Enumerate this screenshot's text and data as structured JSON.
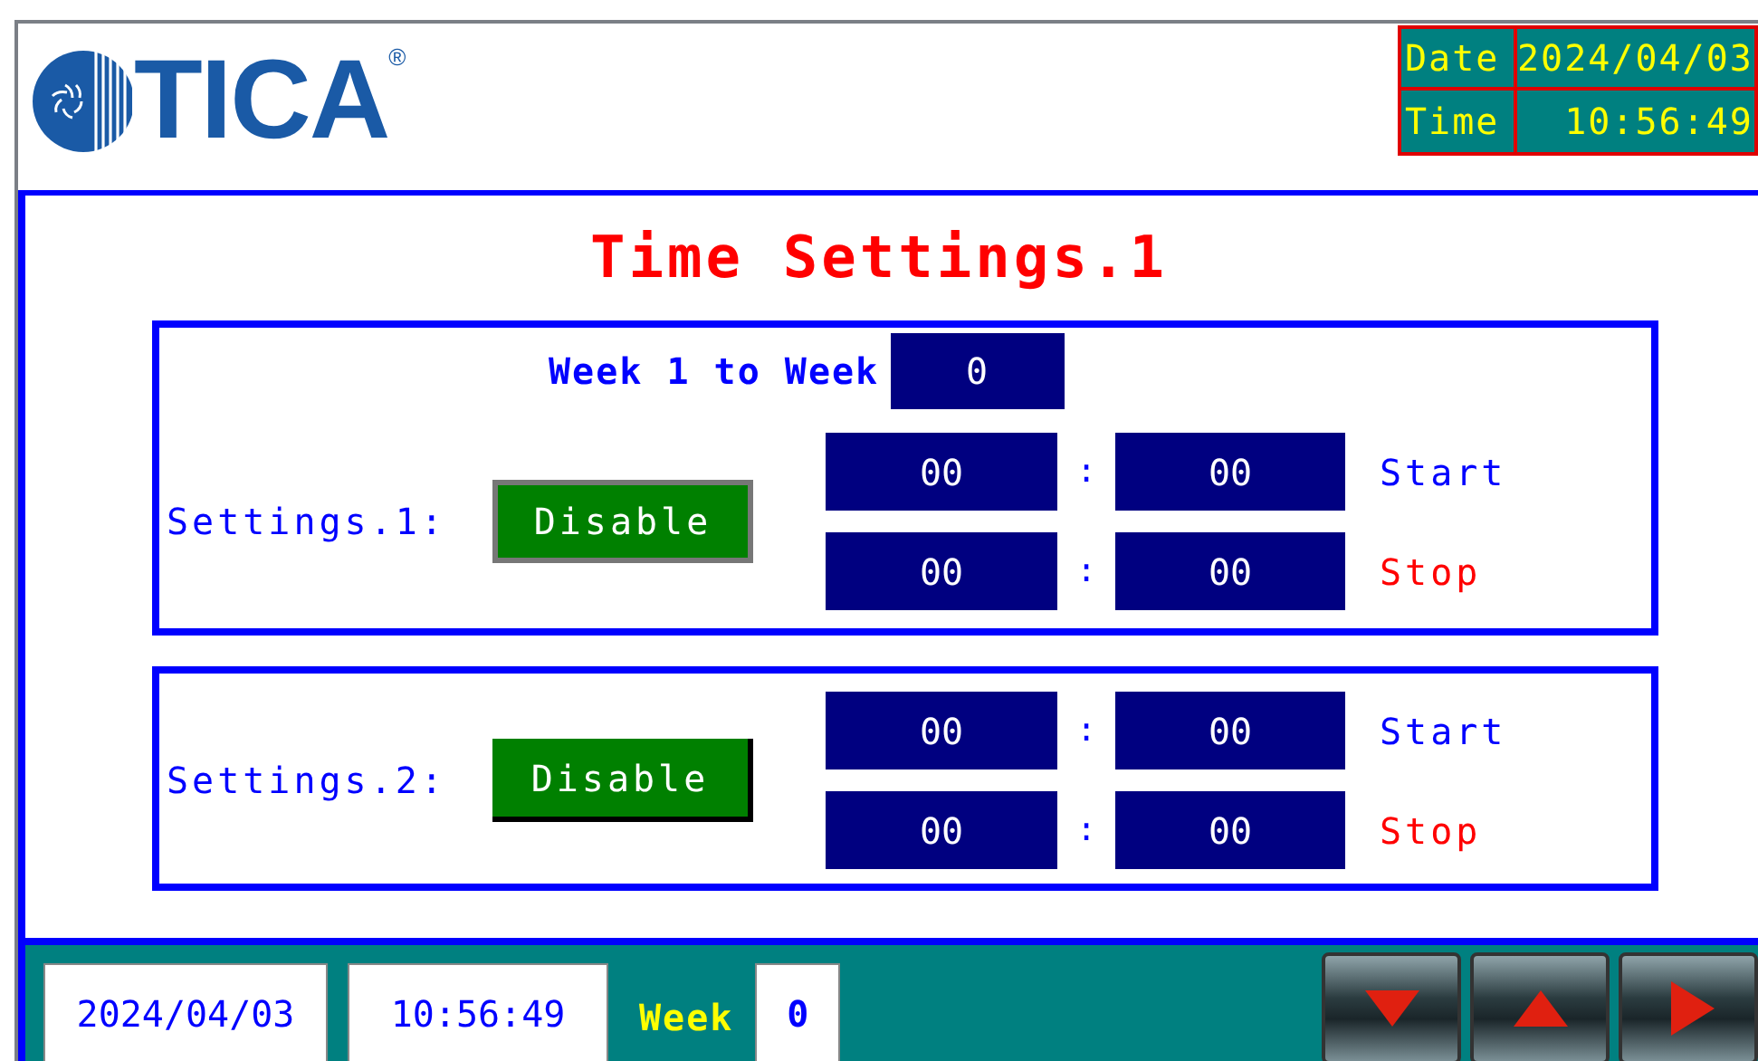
{
  "header": {
    "logo": "TICA",
    "registered": "®",
    "date_label": "Date",
    "date": "2024/04/03",
    "time_label": "Time",
    "time": "10:56:49"
  },
  "title": "Time Settings.1",
  "settings": [
    {
      "label": "Settings.1:",
      "button": "Disable",
      "focused": true,
      "week_range": {
        "label": "Week 1 to Week",
        "value": "0"
      },
      "rows": [
        {
          "hour": "00",
          "separator": ":",
          "minute": "00",
          "action": "Start",
          "kind": "start"
        },
        {
          "hour": "00",
          "separator": ":",
          "minute": "00",
          "action": "Stop",
          "kind": "stop"
        }
      ]
    },
    {
      "label": "Settings.2:",
      "button": "Disable",
      "focused": false,
      "rows": [
        {
          "hour": "00",
          "separator": ":",
          "minute": "00",
          "action": "Start",
          "kind": "start"
        },
        {
          "hour": "00",
          "separator": ":",
          "minute": "00",
          "action": "Stop",
          "kind": "stop"
        }
      ]
    }
  ],
  "footer": {
    "date": "2024/04/03",
    "time": "10:56:49",
    "week_label": "Week",
    "week": "0",
    "nav_buttons": [
      {
        "kind": "down"
      },
      {
        "kind": "up"
      },
      {
        "kind": "right"
      }
    ]
  }
}
